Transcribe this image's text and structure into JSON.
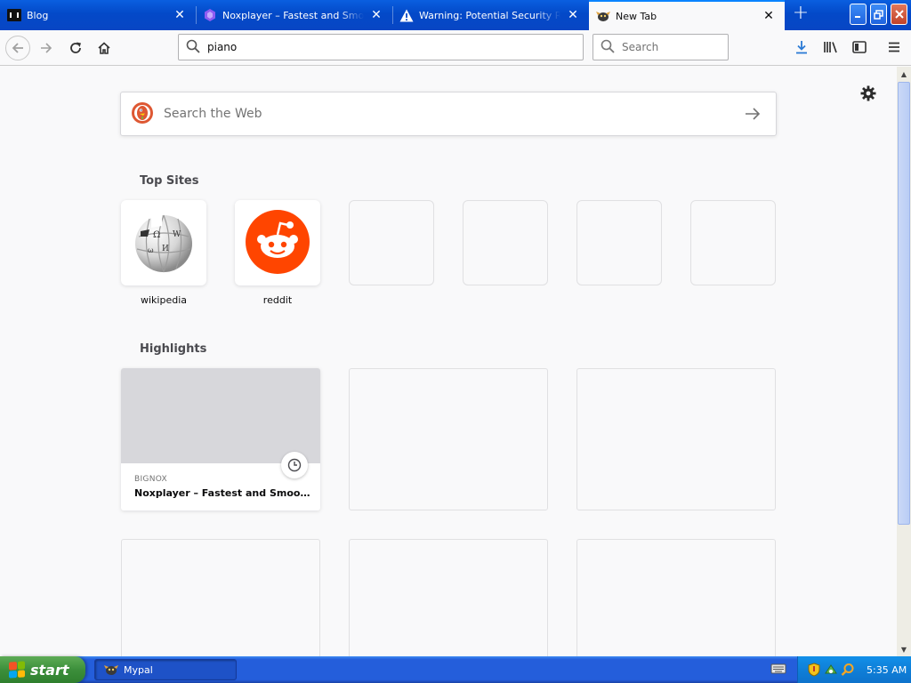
{
  "tabs": [
    {
      "title": "Blog",
      "icon": "blog-favicon-icon",
      "active": false
    },
    {
      "title": "Noxplayer – Fastest and Smoothest Android Emulator",
      "icon": "noxplayer-favicon-icon",
      "active": false
    },
    {
      "title": "Warning: Potential Security Risk Ahead",
      "icon": "warning-icon",
      "active": false
    },
    {
      "title": "New Tab",
      "icon": "mypal-favicon-icon",
      "active": true
    }
  ],
  "navbar": {
    "url_value": "piano",
    "search_placeholder": "Search"
  },
  "newtab": {
    "web_search_placeholder": "Search the Web",
    "top_sites_title": "Top Sites",
    "top_sites": [
      {
        "label": "wikipedia",
        "icon": "wikipedia-logo-icon"
      },
      {
        "label": "reddit",
        "icon": "reddit-logo-icon"
      }
    ],
    "highlights_title": "Highlights",
    "highlights": [
      {
        "source": "BIGNOX",
        "title": "Noxplayer – Fastest and Smooth..."
      }
    ]
  },
  "taskbar": {
    "start_label": "start",
    "tasks": [
      {
        "label": "Mypal",
        "icon": "mypal-icon"
      }
    ],
    "clock": "5:35 AM"
  },
  "colors": {
    "xp_blue": "#0349c8",
    "accent": "#0a84ff",
    "reddit": "#ff4500",
    "start_green": "#3c8f3b",
    "duckduckgo": "#de5833"
  }
}
